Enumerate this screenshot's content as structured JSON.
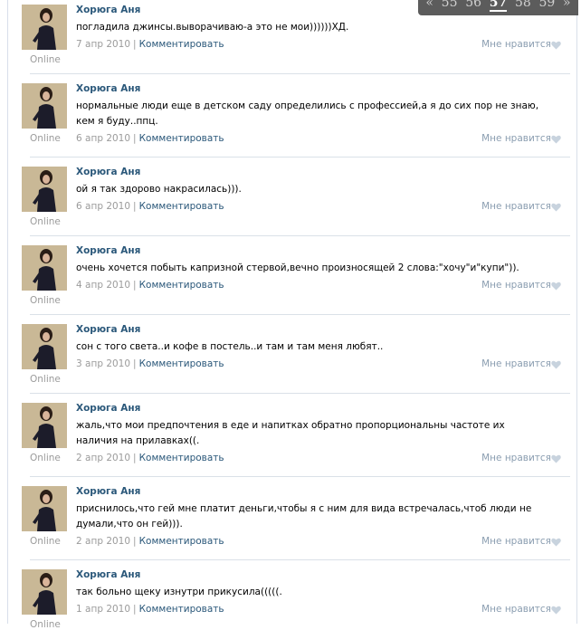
{
  "pager": {
    "prev": "«",
    "pages": [
      "55",
      "56",
      "57",
      "58",
      "59"
    ],
    "current": "57",
    "next": "»"
  },
  "labels": {
    "comment": "Комментировать",
    "like": "Мне нравится",
    "status": "Online",
    "separator": "|"
  },
  "posts": [
    {
      "author": "Хорюга Аня",
      "text": "погладила джинсы.выворачиваю-а это не мои))))))ХД.",
      "date": "7 апр 2010"
    },
    {
      "author": "Хорюга Аня",
      "text": "нормальные люди еще в детском саду определились с профессией,а я до сих пор не знаю, кем я буду..ппц.",
      "date": "6 апр 2010"
    },
    {
      "author": "Хорюга Аня",
      "text": "ой я так здорово накрасилась))).",
      "date": "6 апр 2010"
    },
    {
      "author": "Хорюга Аня",
      "text": "очень хочется побыть капризной стервой,вечно произносящей 2 слова:\"хочу\"и\"купи\")).",
      "date": "4 апр 2010"
    },
    {
      "author": "Хорюга Аня",
      "text": "сон с того света..и кофе в постель..и там и там меня любят..",
      "date": "3 апр 2010"
    },
    {
      "author": "Хорюга Аня",
      "text": "жаль,что мои предпочтения в еде и напитках обратно пропорциональны частоте их наличия на прилавках((.",
      "date": "2 апр 2010"
    },
    {
      "author": "Хорюга Аня",
      "text": "приснилось,что гей мне платит деньги,чтобы я с ним для вида встречалась,чтоб люди не думали,что он гей))).",
      "date": "2 апр 2010"
    },
    {
      "author": "Хорюга Аня",
      "text": "так больно щеку изнутри прикусила(((((.",
      "date": "1 апр 2010"
    }
  ]
}
